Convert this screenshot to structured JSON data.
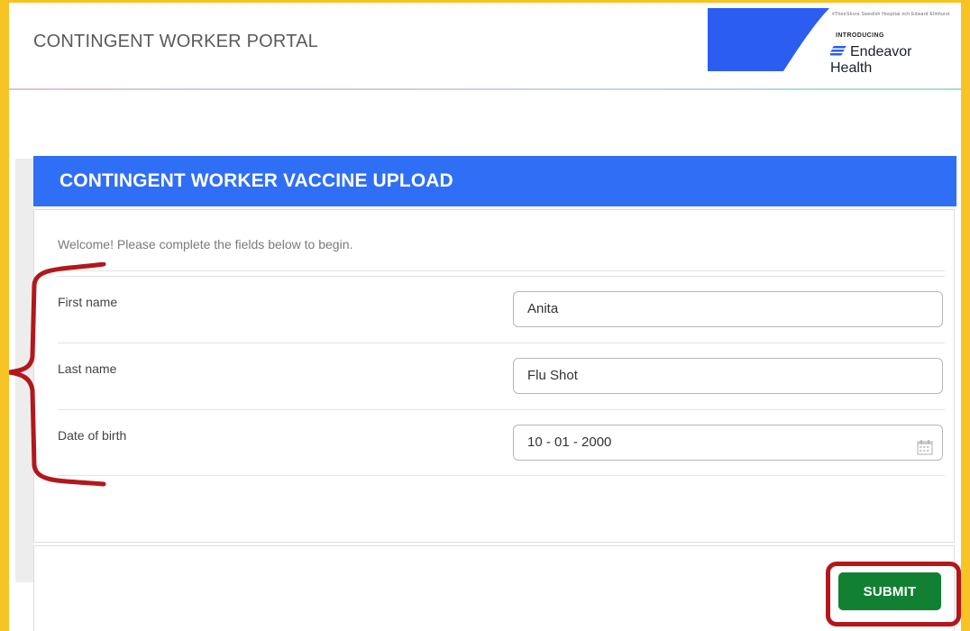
{
  "header": {
    "portal_title": "CONTINGENT WORKER PORTAL",
    "logo": {
      "top_line": "#TheirShore  Swedish Hospital  nch  Edward Elmhurst",
      "introducing": "INTRODUCING",
      "name": "Endeavor Health",
      "icon": "endeavor-stripes-icon"
    }
  },
  "card": {
    "title": "CONTINGENT WORKER VACCINE UPLOAD",
    "welcome": "Welcome! Please complete the fields below to begin.",
    "fields": [
      {
        "label": "First name",
        "value": "Anita"
      },
      {
        "label": "Last name",
        "value": "Flu Shot"
      },
      {
        "label": "Date of birth",
        "value": "10 - 01 - 2000",
        "icon": "calendar-icon"
      }
    ],
    "submit_label": "SUBMIT"
  },
  "colors": {
    "frame": "#f7c325",
    "banner": "#2f6ff5",
    "submit": "#128032",
    "annotation": "#b3171c",
    "logo_blue": "#2b5ef0"
  }
}
